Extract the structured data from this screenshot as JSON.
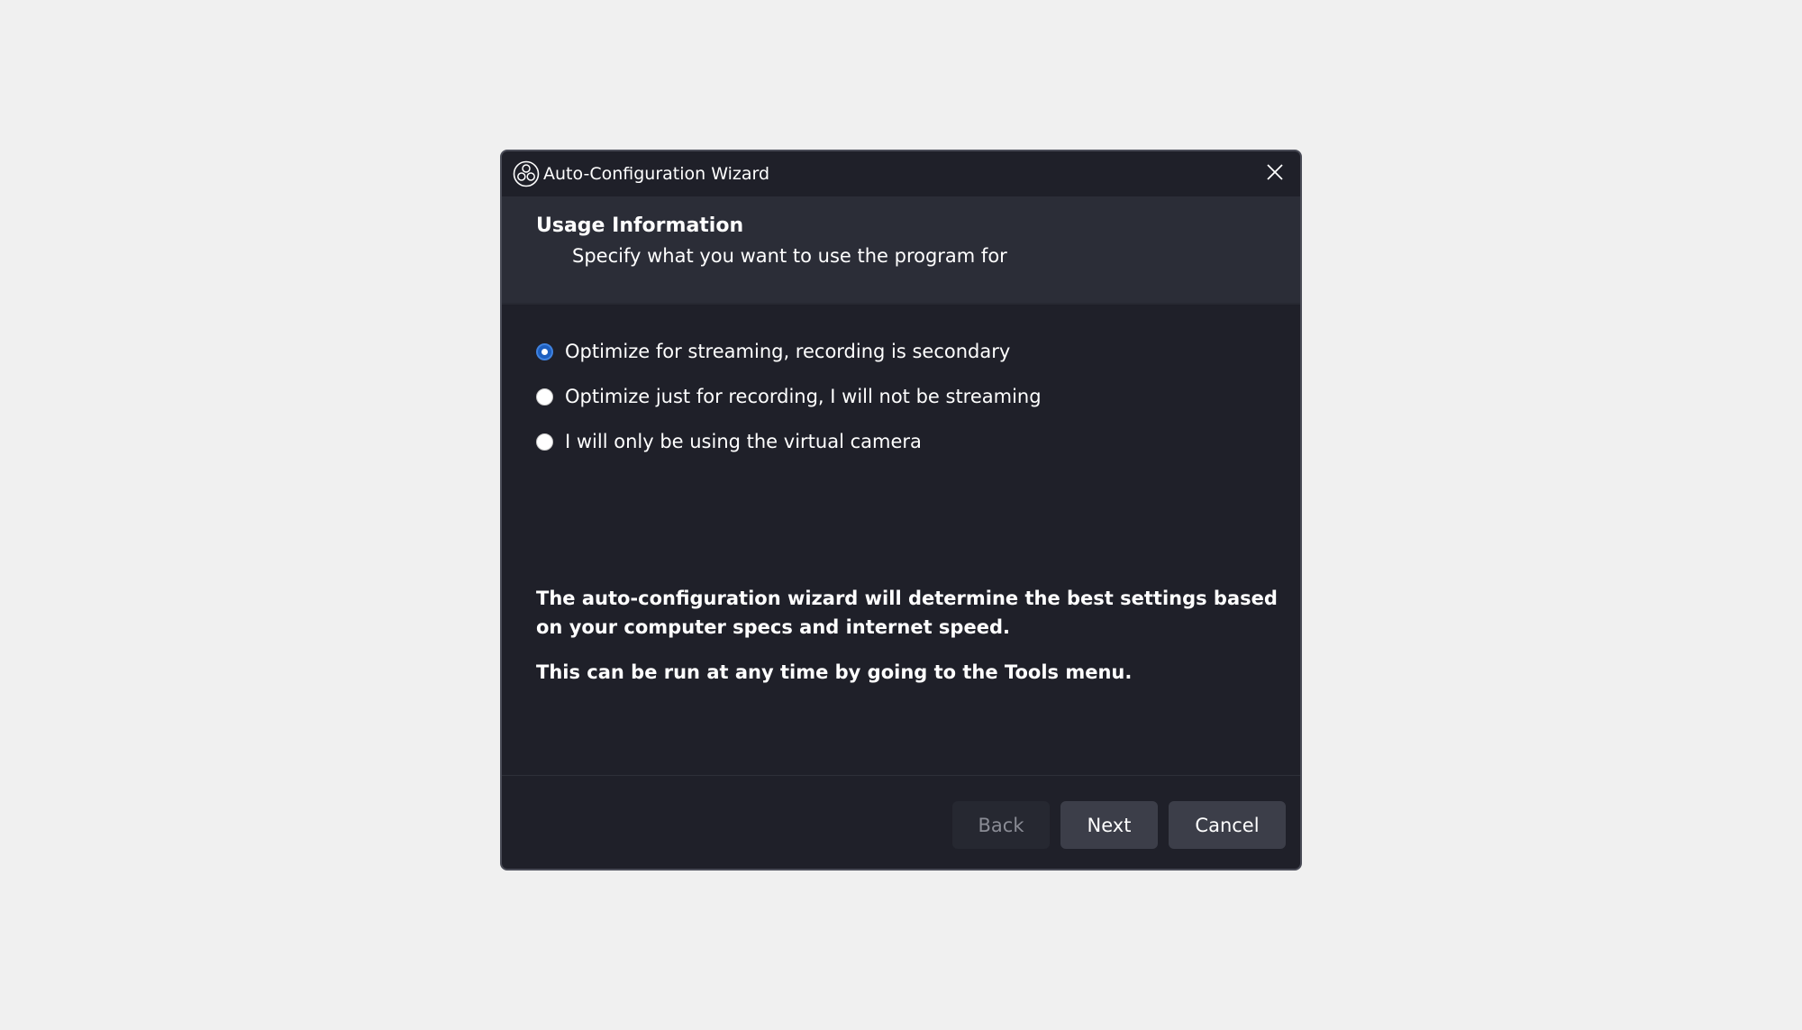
{
  "window": {
    "title": "Auto-Configuration Wizard",
    "app_icon": "obs-logo-icon",
    "close_icon": "close-icon"
  },
  "header": {
    "title": "Usage Information",
    "subtitle": "Specify what you want to use the program for"
  },
  "options": [
    {
      "label": "Optimize for streaming, recording is secondary",
      "selected": true
    },
    {
      "label": "Optimize just for recording, I will not be streaming",
      "selected": false
    },
    {
      "label": "I will only be using the virtual camera",
      "selected": false
    }
  ],
  "info": {
    "line1": "The auto-configuration wizard will determine the best settings based on your computer specs and internet speed.",
    "line2": "This can be run at any time by going to the Tools menu."
  },
  "buttons": {
    "back": "Back",
    "next": "Next",
    "cancel": "Cancel",
    "back_enabled": false
  },
  "colors": {
    "dialog_bg": "#1f2029",
    "header_bg": "#2b2d37",
    "accent": "#1d5fbf",
    "page_bg": "#f0f0f0"
  }
}
